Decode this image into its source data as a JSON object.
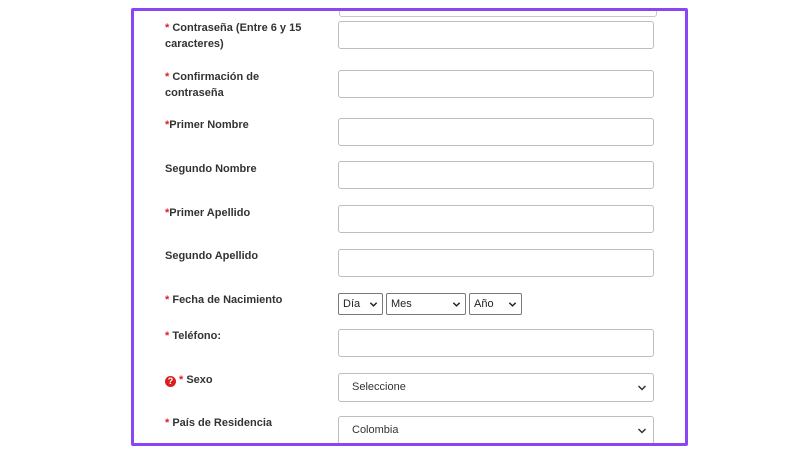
{
  "form": {
    "fields": {
      "password": {
        "required": "*",
        "label": "Contraseña (Entre 6 y 15 caracteres)",
        "value": ""
      },
      "password_confirm": {
        "required": "*",
        "label": "Confirmación de contraseña",
        "value": ""
      },
      "first_name": {
        "required": "*",
        "label": "Primer Nombre",
        "value": ""
      },
      "second_name": {
        "label": "Segundo Nombre",
        "value": ""
      },
      "first_surname": {
        "required": "*",
        "label": "Primer Apellido",
        "value": ""
      },
      "second_surname": {
        "label": "Segundo Apellido",
        "value": ""
      },
      "birth_date": {
        "required": "*",
        "label": "Fecha de Nacimiento",
        "day": "Día",
        "month": "Mes",
        "year": "Año"
      },
      "phone": {
        "required": "*",
        "label": "Teléfono:",
        "value": ""
      },
      "sex": {
        "help_icon": "?",
        "required": "*",
        "label": "Sexo",
        "selected": "Seleccione"
      },
      "country": {
        "required": "*",
        "label": "País de Residencia",
        "selected": "Colombia"
      }
    }
  },
  "colors": {
    "highlight_border": "#8a45f5",
    "required_mark": "#e11d1d"
  },
  "icons": {
    "dropdown": "chevron-down-icon",
    "help": "question-circle-icon"
  }
}
